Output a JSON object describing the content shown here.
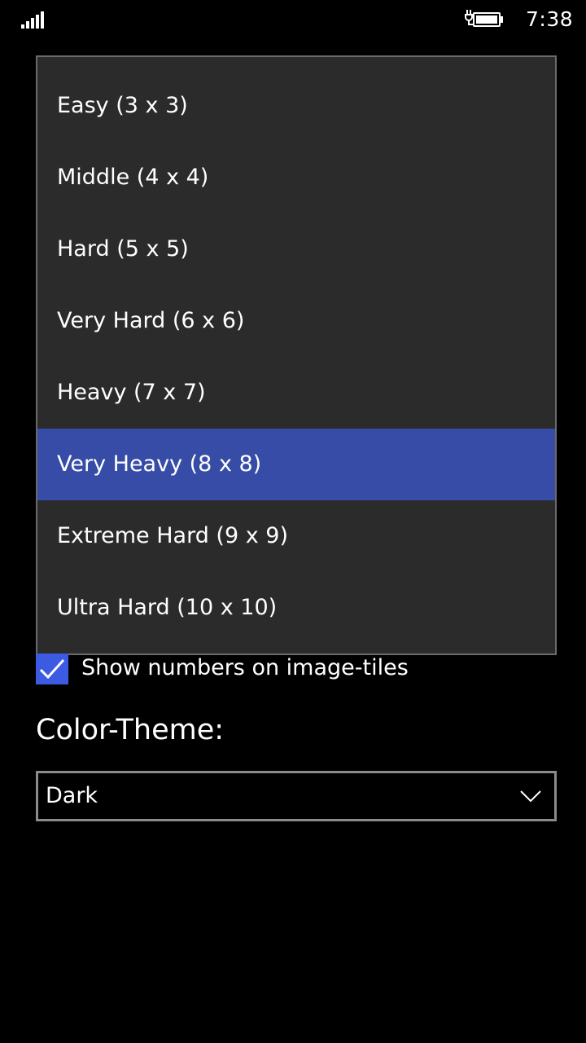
{
  "status_bar": {
    "time": "7:38",
    "signal_icon": "signal-bars-icon",
    "battery_icon": "battery-charging-icon"
  },
  "difficulty_dropdown": {
    "options": [
      "Easy (3 x 3)",
      "Middle (4 x 4)",
      "Hard (5 x 5)",
      "Very Hard (6 x 6)",
      "Heavy (7 x 7)",
      "Very Heavy (8 x 8)",
      "Extreme Hard (9 x 9)",
      "Ultra Hard (10 x 10)"
    ],
    "selected": "Very Heavy (8 x 8)"
  },
  "show_numbers": {
    "label": "Show numbers on image-tiles",
    "checked": true
  },
  "color_theme": {
    "heading": "Color-Theme:",
    "value": "Dark",
    "icon": "chevron-down-icon"
  },
  "colors": {
    "background": "#000000",
    "dropdown_bg": "#2b2b2b",
    "accent_selected": "#364ca7",
    "checkbox_accent": "#3c5be2"
  }
}
